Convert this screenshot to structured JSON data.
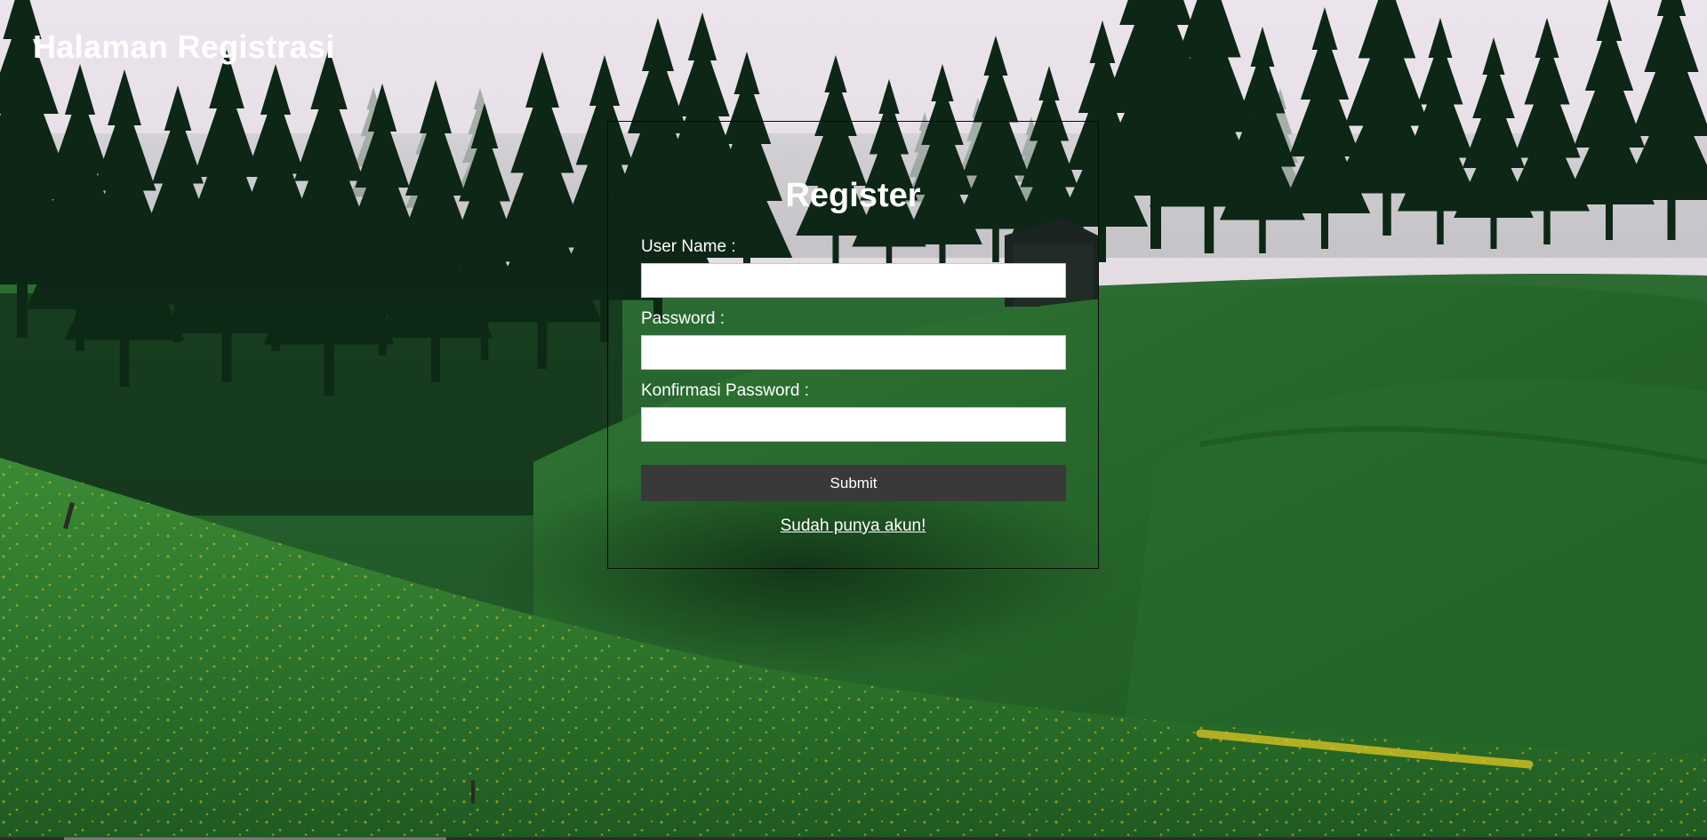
{
  "page": {
    "title": "Halaman Registrasi"
  },
  "form": {
    "title": "Register",
    "fields": [
      {
        "label": "User Name :",
        "value": "",
        "placeholder": ""
      },
      {
        "label": "Password :",
        "value": "",
        "placeholder": ""
      },
      {
        "label": "Konfirmasi Password :",
        "value": "",
        "placeholder": ""
      }
    ],
    "submit_label": "Submit",
    "login_link": "Sudah punya akun!"
  },
  "colors": {
    "text": "#ffffff",
    "button_bg": "#393939",
    "box_border": "#0a0a0a",
    "sky": "#e9e2e9",
    "forest": "#0f2a18",
    "meadow": "#2a6e30"
  }
}
